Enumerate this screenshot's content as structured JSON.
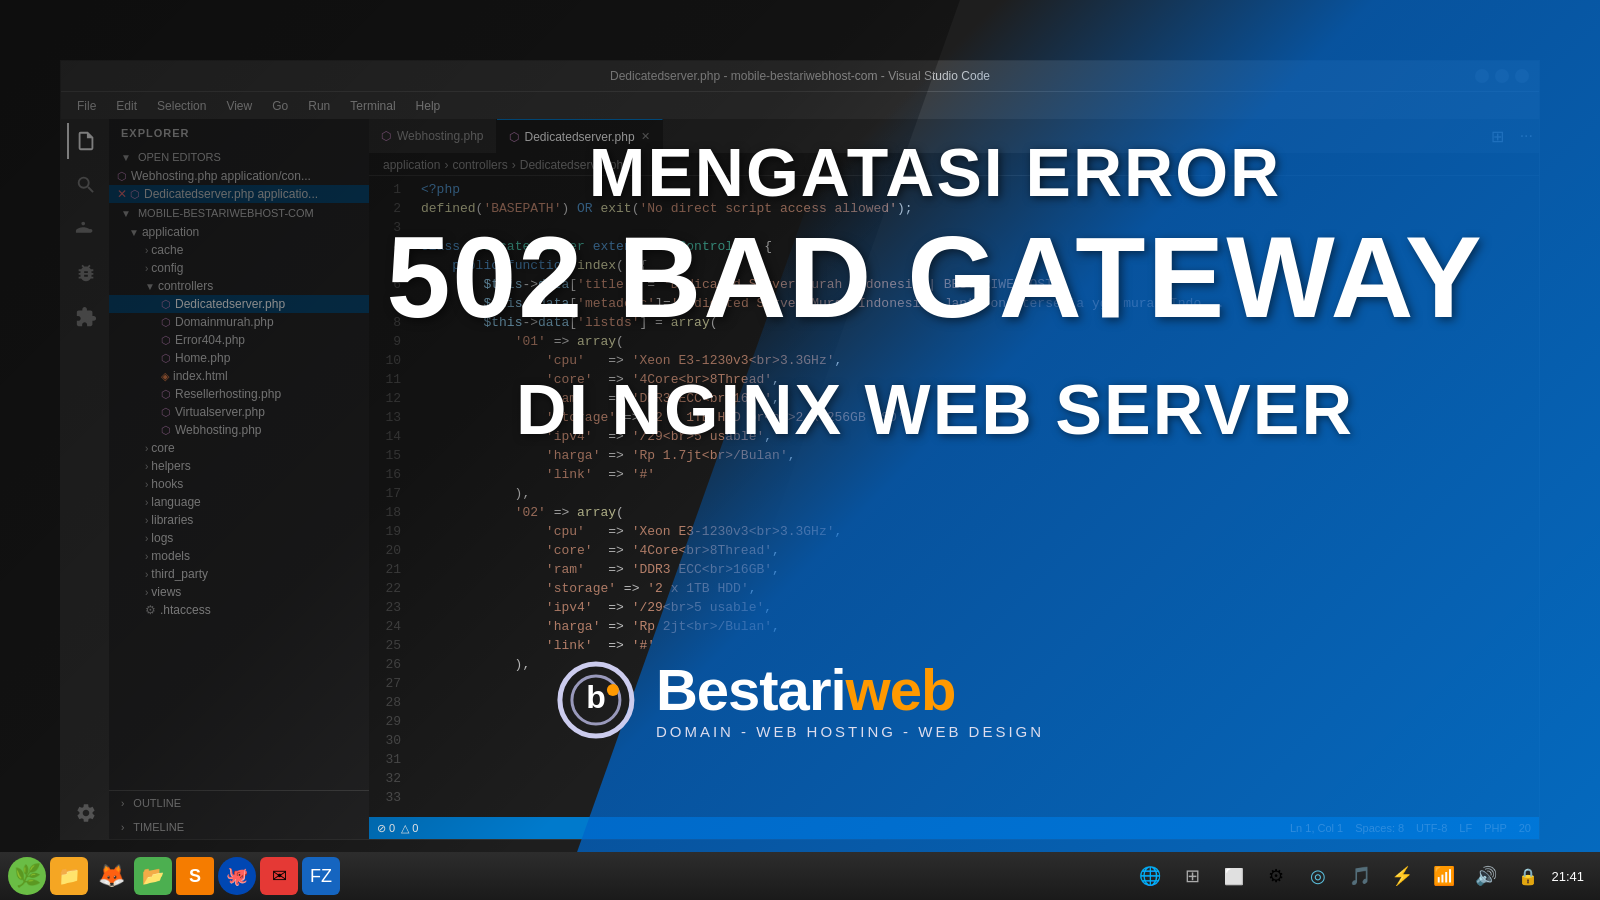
{
  "window": {
    "title": "Dedicatedserver.php - mobile-bestariwebhost-com - Visual Studio Code",
    "controls": [
      "minimize",
      "maximize",
      "close"
    ]
  },
  "menu": {
    "items": [
      "File",
      "Edit",
      "Selection",
      "View",
      "Go",
      "Run",
      "Terminal",
      "Help"
    ]
  },
  "sidebar": {
    "header": "EXPLORER",
    "sections": {
      "openEditors": "OPEN EDITORS",
      "projectName": "MOBILE-BESTARIWEBHOST-COM"
    },
    "openEditors": [
      {
        "name": "Webhosting.php",
        "path": "application/con..."
      },
      {
        "name": "Dedicatedserver.php",
        "path": "applicatio...",
        "active": true
      }
    ],
    "tree": {
      "application": {
        "cache": "cache",
        "config": "config",
        "controllers": {
          "files": [
            "Dedicatedserver.php",
            "Domainmurah.php",
            "Error404.php",
            "Home.php",
            "index.html",
            "Resellerhosting.php",
            "Virtualserver.php",
            "Webhosting.php"
          ]
        },
        "core": "core",
        "helpers": "helpers",
        "hooks": "hooks",
        "language": "language",
        "libraries": "libraries",
        "logs": "logs",
        "models": "models",
        "third_party": "third_party",
        "views": "views",
        "htaccess": ".htaccess"
      }
    },
    "outline": "OUTLINE",
    "timeline": "TIMELINE"
  },
  "tabs": [
    {
      "name": "Webhosting.php",
      "active": false
    },
    {
      "name": "Dedicatedserver.php",
      "active": true
    }
  ],
  "breadcrumb": {
    "path": [
      "application",
      ">",
      "controllers",
      ">",
      "Dedicatedserver.php"
    ]
  },
  "code": {
    "lines": [
      "<?php",
      "defined('BASEPATH') OR exit('No direct script access allowed');",
      "",
      "class Dedicatedserver extends BW_Controller {",
      "    public function index() {",
      "        $this->data['title'] = 'Dedicated Server Murah Indonesia | BESTARIWEBHOST';",
      "        $this->data['metadesc']='Dedicated Server Murah Indonesia, Janta-ons tersedia ygs murah Indo...",
      "        $this->data['listds'] = array(",
      "            '01' => array(",
      "                'cpu'   => 'Xeon E3-1230v3<br>3.3GHz',",
      "                'core'  => '4Core<br>8Thread',",
      "                'ram'   => 'DDR3 ECC<br>16GB',",
      "                'storage' => '2 x 1TB HDD or<br>2 x 256GB SSD',",
      "                'ipv4'  => '/29<br>5 usable',",
      "                'harga' => 'Rp 1.7jt<br>/Bulan',",
      "                'link'  => '#'",
      "            ),",
      "            '02' => array(",
      "                'cpu'   => 'Xeon E3-1230v3<br>3.3GHz',",
      "                'core'  => '4Core<br>8Thread',",
      "                'ram'   => 'DDR3 ECC<br>16GB',",
      "                'storage' => '2 x 1TB HDD',",
      "                'ipv4'  => '/29<br>5 usable',",
      "                'harga' => 'Rp 2jt<br>/Bulan',",
      "                'link'  => '#'"
    ],
    "lineCount": 33
  },
  "statusBar": {
    "left": [
      "0 errors",
      "0 warnings"
    ],
    "right": [
      "Ln 1, Col 1",
      "Spaces: 8",
      "UTF-8",
      "LF",
      "PHP",
      "20"
    ]
  },
  "overlay": {
    "headline_top": "MENGATASI ERROR",
    "headline_main": "502 BAD GATEWAY",
    "headline_sub": "DI NGINX WEB SERVER",
    "logo": {
      "name_part1": "Bestari",
      "name_part2": "web",
      "tagline": "DOMAIN - WEB HOSTING - WEB DESIGN"
    }
  },
  "taskbar": {
    "time": "21:41",
    "apps": [
      {
        "name": "linux-mint-icon",
        "label": "Linux Mint"
      },
      {
        "name": "files-icon",
        "label": "Files"
      },
      {
        "name": "firefox-icon",
        "label": "Firefox"
      },
      {
        "name": "folder-icon",
        "label": "Folder"
      },
      {
        "name": "sublime-icon",
        "label": "Sublime Text"
      },
      {
        "name": "sourcetree-icon",
        "label": "SourceTree"
      },
      {
        "name": "email-icon",
        "label": "Email"
      },
      {
        "name": "filezilla-icon",
        "label": "FileZilla"
      }
    ]
  }
}
